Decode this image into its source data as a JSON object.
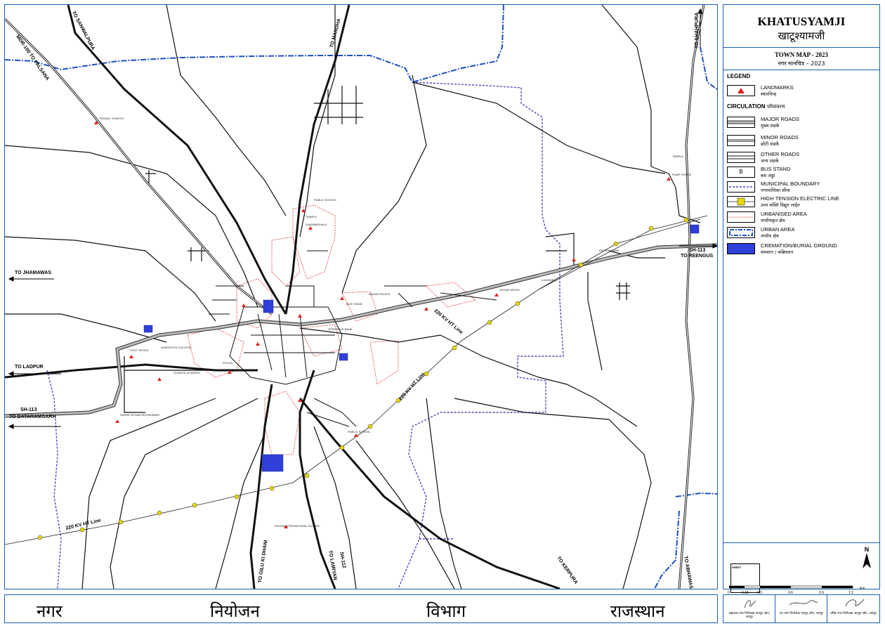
{
  "title": {
    "town_en": "KHATUSYAMJI",
    "town_hi": "खाटूश्यामजी",
    "map_en": "TOWN MAP - 2023",
    "map_hi": "नगर मानचित्र – 2023"
  },
  "legend": {
    "heading": "LEGEND",
    "landmarks": {
      "en": "LANDMARKS",
      "hi": "स्थलचिन्ह"
    },
    "circulation_en": "CIRCULATION",
    "circulation_hi": "परिसंचरण",
    "items": [
      {
        "en": "MAJOR ROADS",
        "hi": "मुख्य सड़कें"
      },
      {
        "en": "MINOR ROADS",
        "hi": "छोटी सड़कें"
      },
      {
        "en": "OTHER ROADS",
        "hi": "अन्य सड़कें"
      },
      {
        "en": "BUS STAND",
        "hi": "बस अड्डा",
        "symbol": "B"
      },
      {
        "en": "MUNICIPAL BOUNDARY",
        "hi": "नगरपालिका सीमा"
      },
      {
        "en": "HIGH TENSION ELECTRIC LINE",
        "hi": "उच्च शक्ति विद्युत लाईन"
      },
      {
        "en": "URBANISED AREA",
        "hi": "नगरीयकृत क्षेत्र"
      },
      {
        "en": "URBAN AREA",
        "hi": "नगरीय क्षेत्र"
      },
      {
        "en": "CREMATION/BURIAL GROUND",
        "hi": "शमशान / कब्रिस्तान"
      }
    ]
  },
  "north": "N",
  "sheet": {
    "label": "SHEET",
    "scale": [
      "0",
      "0.15",
      "0.3",
      "0.6",
      "0.9",
      "1.2"
    ],
    "unit": "Km"
  },
  "footer": {
    "words": [
      "नगर",
      "नियोजन",
      "विभाग",
      "राजस्थान"
    ]
  },
  "signatures": [
    "सहायक नगर नियोजक जयपुर ज़ोन, जयपुर",
    "उप नगर नियोजक जयपुर ज़ोन, जयपुर",
    "वरिष्ठ नगर नियोजक जयपुर ज़ोन, जयपुर"
  ],
  "map_labels": {
    "mdr100": "MDR-100 TO PALSANA",
    "sanwalpura": "TO SANWALPURA",
    "mandha": "TO MANDHA",
    "shahpura": "TO SHAHPURA",
    "jhamawas": "TO JHAMAWAS",
    "ladpur": "TO LADPUR",
    "sh113_west": "SH-113",
    "dataramgarh": "TO DATARAMGARH",
    "sh113_east": "SH-113",
    "reengus": "TO REENGUS",
    "gilu": "TO GILU KI DHANI",
    "sh112": "SH-112",
    "lamiyan": "TO LAMIYAN",
    "kerpura": "TO KERPURA",
    "abhawas": "TO ABHAWAS",
    "ht_line_1": "220 KV HT Line",
    "ht_line_2": "220 KV HT Line",
    "ht_line_3": "220 KV HT Line"
  },
  "small_labels": [
    "TEKANO. KHATOO",
    "PUBLIC SCHOOL",
    "TEMPLE",
    "DHARAMSHALA",
    "BUS STAND",
    "BAGAR PALACE",
    "PETROL PUMP",
    "SHYAM VATIKA",
    "LAXMIDEVI",
    "OPERATIVE BANK",
    "POLICE",
    "POST OFFICE",
    "ADARSH PG COLLEGE",
    "SHREE SHYAM RESTAURANT",
    "SCIENCE ACADEMY",
    "PUBLIC SCHOOL",
    "SHYAM INTERNATIONAL SCHOOL",
    "TEMPLE",
    "PUMP OFFICE"
  ]
}
